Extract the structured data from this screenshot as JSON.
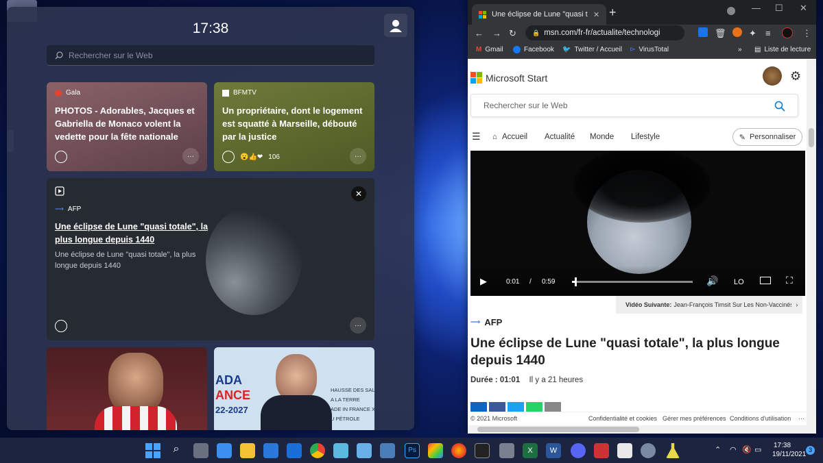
{
  "widgets": {
    "clock": "17:38",
    "search_placeholder": "Rechercher sur le Web",
    "cards": [
      {
        "source": "Gala",
        "title": "PHOTOS - Adorables, Jacques et Gabriella de Monaco volent la vedette pour la fête nationale"
      },
      {
        "source": "BFMTV",
        "title": "Un propriétaire, dont le logement est squatté à Marseille, débouté par la justice",
        "reaction_count": "106"
      },
      {
        "source": "AFP",
        "title": "Une éclipse de Lune \"quasi totale\", la plus longue depuis 1440",
        "summary": "Une éclipse de Lune \"quasi totale\", la plus longue depuis 1440"
      }
    ],
    "image_card_text": [
      "ADA",
      "ANCE",
      "22-2027",
      "HAUSSE DES SALAIR",
      "A LA TERRE",
      "ADE IN FRANCE X",
      "U PÉTROLE"
    ]
  },
  "browser": {
    "tab_title": "Une éclipse de Lune \"quasi totale\"",
    "url": "msn.com/fr-fr/actualite/technologie...",
    "bookmarks": [
      "Gmail",
      "Facebook",
      "Twitter / Accueil",
      "VirusTotal"
    ],
    "reading_list": "Liste de lecture",
    "page": {
      "brand": "Microsoft Start",
      "search_placeholder": "Rechercher sur le Web",
      "nav": [
        "Accueil",
        "Actualité",
        "Monde",
        "Lifestyle"
      ],
      "personalize": "Personnaliser",
      "video": {
        "current": "0:01",
        "separator": "/",
        "duration": "0:59",
        "progress": 0.02,
        "quality": "LO"
      },
      "next_video_label": "Vidéo Suivante:",
      "next_video_title": "Jean-François Timsit Sur Les Non-Vaccinés: \\",
      "article_source": "AFP",
      "article_title": "Une éclipse de Lune \"quasi totale\", la plus longue depuis 1440",
      "duration_label": "Durée : 01:01",
      "posted": "Il y a 21 heures",
      "footer": [
        "© 2021 Microsoft",
        "Confidentialité et cookies",
        "Gérer mes préférences",
        "Conditions d'utilisation"
      ]
    }
  },
  "taskbar": {
    "time": "17:38",
    "date": "19/11/2021",
    "notification_count": "3"
  },
  "colors": {
    "accent": "#0078d4",
    "card_gala": "#6b4a52",
    "card_bfmtv": "#5e6b2e",
    "card_afp": "#24292f"
  }
}
